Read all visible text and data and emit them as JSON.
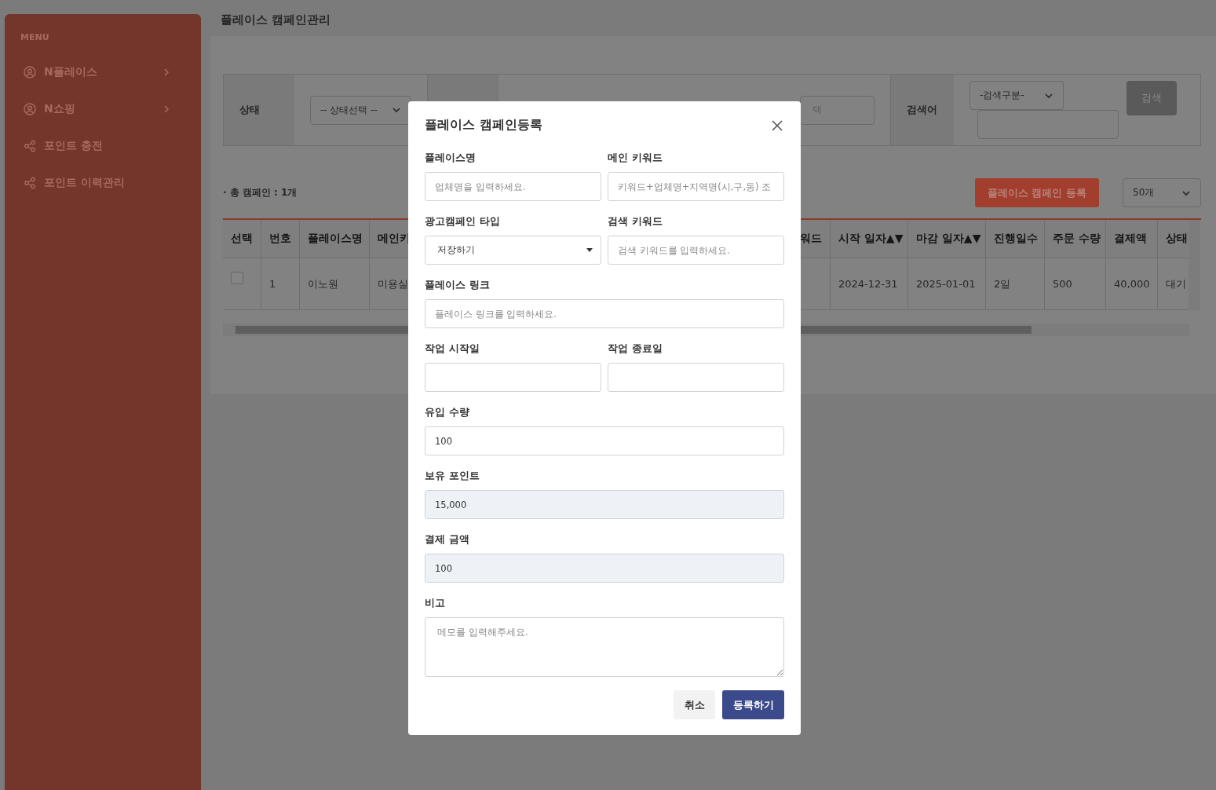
{
  "sidebar": {
    "heading": "MENU",
    "items": [
      {
        "label": "N플레이스",
        "kind": "group"
      },
      {
        "label": "N쇼핑",
        "kind": "group"
      },
      {
        "label": "포인트 충전",
        "kind": "link"
      },
      {
        "label": "포인트 이력관리",
        "kind": "link"
      }
    ]
  },
  "page_title": "플레이스 캠페인관리",
  "filters": {
    "status_label": "상태",
    "status_select": "-- 상태선택 --",
    "partial_placeholder": "택",
    "search_label": "검색어",
    "search_type_select": "-검색구분-",
    "search_button": "검색"
  },
  "summary": "· 총 캠페인 : 1개",
  "register_button": "플레이스 캠페인 등록",
  "page_size": "50개",
  "table": {
    "columns": [
      "선택",
      "번호",
      "플레이스명",
      "메인키",
      "워드",
      "시작 일자▲▼",
      "마감 일자▲▼",
      "진행일수",
      "주문 수량",
      "결제액",
      "상태"
    ],
    "rows": [
      {
        "checked": false,
        "cells": [
          "",
          "1",
          "이노원",
          "미용실",
          "",
          "2024-12-31",
          "2025-01-01",
          "2일",
          "500",
          "40,000",
          "대기"
        ]
      }
    ]
  },
  "modal": {
    "title": "플레이스 캠페인등록",
    "rows": [
      [
        {
          "kind": "text",
          "label": "플레이스명",
          "placeholder": "업체명을 입력하세요."
        },
        {
          "kind": "text",
          "label": "메인 키워드",
          "placeholder": "키워드+업체명+지역명(시,구,동) 조"
        }
      ],
      [
        {
          "kind": "select",
          "label": "광고캠페인 타입",
          "value": "저장하기"
        },
        {
          "kind": "text",
          "label": "검색 키워드",
          "placeholder": "검색 키워드를 입력하세요."
        }
      ],
      [
        {
          "kind": "text",
          "label": "플레이스 링크",
          "placeholder": "플레이스 링크를 입력하세요."
        }
      ],
      [
        {
          "kind": "text",
          "label": "작업 시작일"
        },
        {
          "kind": "text",
          "label": "작업 종료일"
        }
      ],
      [
        {
          "kind": "text",
          "label": "유입 수량",
          "value": "100",
          "disabled": false
        }
      ],
      [
        {
          "kind": "text",
          "label": "보유 포인트",
          "value": "15,000",
          "disabled": true
        }
      ],
      [
        {
          "kind": "text",
          "label": "결제 금액",
          "value": "100",
          "disabled": true
        }
      ],
      [
        {
          "kind": "textarea",
          "label": "비고",
          "placeholder": "메모를 입력해주세요."
        }
      ]
    ],
    "cancel_button": "취소",
    "submit_button": "등록하기"
  }
}
